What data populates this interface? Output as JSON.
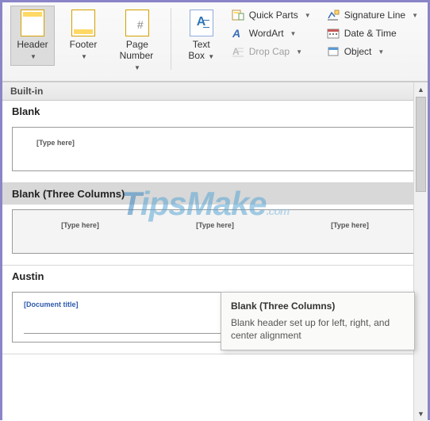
{
  "ribbon": {
    "header": "Header",
    "footer": "Footer",
    "page_number": "Page\nNumber",
    "text_box": "Text\nBox",
    "quick_parts": "Quick Parts",
    "word_art": "WordArt",
    "drop_cap": "Drop Cap",
    "signature_line": "Signature Line",
    "date_time": "Date & Time",
    "object": "Object"
  },
  "gallery": {
    "heading": "Built-in",
    "blank": {
      "title": "Blank",
      "placeholder": "[Type here]"
    },
    "three": {
      "title": "Blank (Three Columns)",
      "placeholder": "[Type here]"
    },
    "austin": {
      "title": "Austin",
      "doctitle": "[Document title]"
    }
  },
  "tooltip": {
    "title": "Blank (Three Columns)",
    "body": "Blank header set up for left, right, and center alignment"
  },
  "watermark": {
    "t": "T",
    "rest": "ipsMake",
    "suffix": ".com"
  }
}
